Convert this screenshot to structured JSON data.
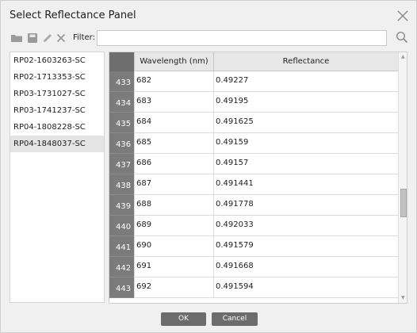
{
  "dialog": {
    "title": "Select Reflectance Panel"
  },
  "toolbar": {
    "filter_label": "Filter:",
    "filter_value": "",
    "icons": [
      "folder-icon",
      "save-icon",
      "edit-icon",
      "delete-icon",
      "search-icon"
    ]
  },
  "panels": [
    {
      "label": "RP02-1603263-SC",
      "selected": false
    },
    {
      "label": "RP02-1713353-SC",
      "selected": false
    },
    {
      "label": "RP03-1731027-SC",
      "selected": false
    },
    {
      "label": "RP03-1741237-SC",
      "selected": false
    },
    {
      "label": "RP04-1808228-SC",
      "selected": false
    },
    {
      "label": "RP04-1848037-SC",
      "selected": true
    }
  ],
  "table": {
    "columns": [
      "Wavelength (nm)",
      "Reflectance"
    ],
    "rows": [
      {
        "index": "433",
        "wavelength": "682",
        "reflectance": "0.49227"
      },
      {
        "index": "434",
        "wavelength": "683",
        "reflectance": "0.49195"
      },
      {
        "index": "435",
        "wavelength": "684",
        "reflectance": "0.491625"
      },
      {
        "index": "436",
        "wavelength": "685",
        "reflectance": "0.49159"
      },
      {
        "index": "437",
        "wavelength": "686",
        "reflectance": "0.49157"
      },
      {
        "index": "438",
        "wavelength": "687",
        "reflectance": "0.491441"
      },
      {
        "index": "439",
        "wavelength": "688",
        "reflectance": "0.491778"
      },
      {
        "index": "440",
        "wavelength": "689",
        "reflectance": "0.492033"
      },
      {
        "index": "441",
        "wavelength": "690",
        "reflectance": "0.491579"
      },
      {
        "index": "442",
        "wavelength": "691",
        "reflectance": "0.491668"
      },
      {
        "index": "443",
        "wavelength": "692",
        "reflectance": "0.491594"
      }
    ]
  },
  "buttons": {
    "ok": "OK",
    "cancel": "Cancel"
  },
  "colors": {
    "dialog_bg": "#f0f0f0",
    "row_header_bg": "#7b7b7b",
    "button_bg": "#6c6c6c",
    "selected_item_bg": "#e4e4e4"
  }
}
